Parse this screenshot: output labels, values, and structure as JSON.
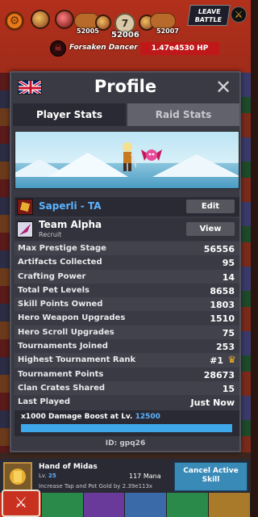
{
  "game": {
    "stage": "52006",
    "stage_badge": "7",
    "prev_stage": "52005",
    "next_stage": "52007",
    "leave_battle": "LEAVE BATTLE",
    "boss_name": "Forsaken Dancer",
    "boss_hp": "1.47e4530 HP"
  },
  "profile": {
    "title": "Profile",
    "close_icon": "close-x-icon",
    "tabs": [
      "Player Stats",
      "Raid Stats"
    ],
    "active_tab": 0,
    "player_name": "Saperli - TA",
    "edit_label": "Edit",
    "clan_name": "Team Alpha",
    "clan_role": "Recruit",
    "view_label": "View",
    "stats": [
      {
        "label": "Max Prestige Stage",
        "value": "56556"
      },
      {
        "label": "Artifacts Collected",
        "value": "95"
      },
      {
        "label": "Crafting Power",
        "value": "14"
      },
      {
        "label": "Total Pet Levels",
        "value": "8658"
      },
      {
        "label": "Skill Points Owned",
        "value": "1803"
      },
      {
        "label": "Hero Weapon Upgrades",
        "value": "1510"
      },
      {
        "label": "Hero Scroll Upgrades",
        "value": "75"
      },
      {
        "label": "Tournaments Joined",
        "value": "253"
      },
      {
        "label": "Highest Tournament Rank",
        "value": "#1"
      },
      {
        "label": "Tournament Points",
        "value": "28673"
      },
      {
        "label": "Clan Crates Shared",
        "value": "15"
      },
      {
        "label": "Last Played",
        "value": "Just Now"
      }
    ],
    "boost_text": "x1000 Damage Boost at Lv.",
    "boost_level": "12500",
    "boost_progress": 1.0,
    "player_id": "ID: gpq26"
  },
  "skill": {
    "name": "Hand of Midas",
    "level_prefix": "Lv.",
    "level": "25",
    "mana": "117 Mana",
    "description": "Increase Tap and Pot Gold by 2.39e113x",
    "cancel_label": "Cancel Active Skill"
  },
  "colors": {
    "accent_blue": "#5cb4ff",
    "boost_fill": "#3ea8ea",
    "crown": "#f0b020"
  }
}
